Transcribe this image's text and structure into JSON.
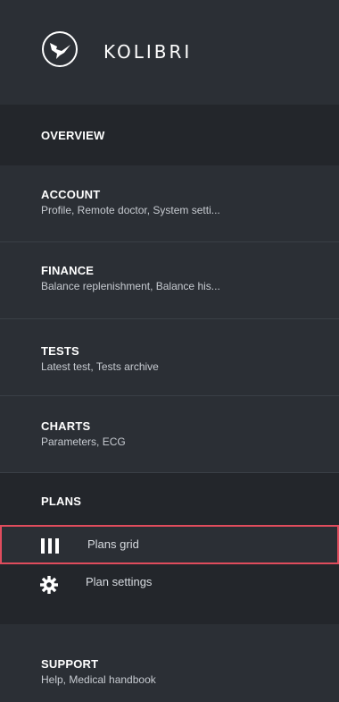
{
  "brand": {
    "name": "KOLIBRI",
    "logo_icon": "hummingbird-icon"
  },
  "sections": [
    {
      "title": "OVERVIEW",
      "subtitle": ""
    },
    {
      "title": "ACCOUNT",
      "subtitle": "Profile, Remote doctor, System setti..."
    },
    {
      "title": "FINANCE",
      "subtitle": "Balance replenishment, Balance his..."
    },
    {
      "title": "TESTS",
      "subtitle": "Latest test, Tests archive"
    },
    {
      "title": "CHARTS",
      "subtitle": "Parameters, ECG"
    },
    {
      "title": "PLANS",
      "subtitle": ""
    },
    {
      "title": "SUPPORT",
      "subtitle": "Help, Medical handbook"
    }
  ],
  "plans_submenu": {
    "items": [
      {
        "label": "Plans grid",
        "icon": "grid-bars-icon",
        "active": true
      },
      {
        "label": "Plan settings",
        "icon": "gear-icon",
        "active": false
      }
    ]
  },
  "colors": {
    "sidebar_bg": "#2b2f35",
    "dark_bg": "#23262b",
    "active_border": "#e04c5d",
    "text": "#ffffff",
    "subtext": "#c7cbd1"
  }
}
